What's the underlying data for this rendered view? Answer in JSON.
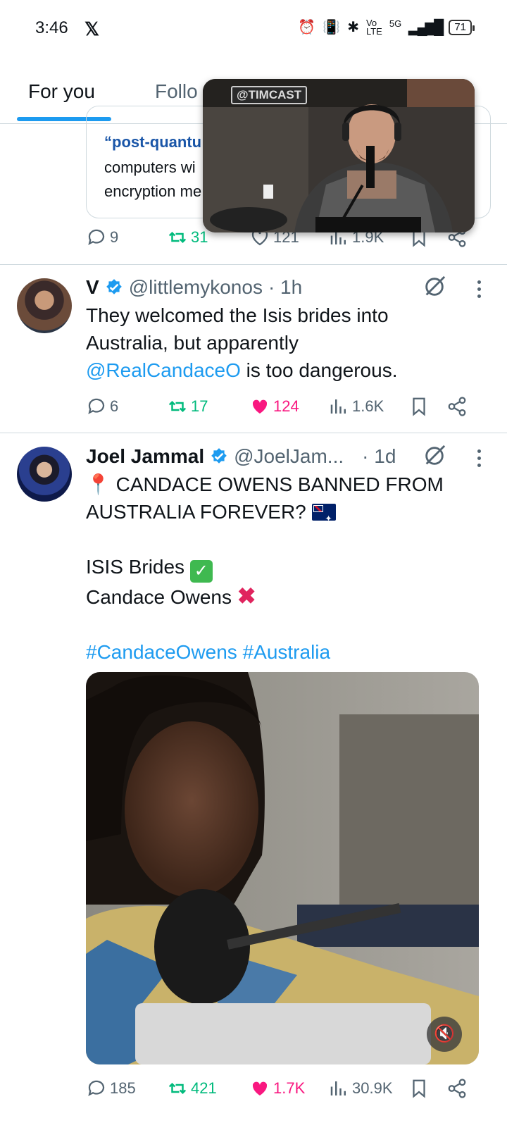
{
  "status_bar": {
    "time": "3:46",
    "x_logo": "𝕏",
    "network": "5G",
    "battery": "71"
  },
  "tabs": [
    {
      "label": "For you",
      "active": true
    },
    {
      "label": "Follo",
      "active": false
    }
  ],
  "quote_card": {
    "line1": "“post-quantu",
    "line2": "computers wi",
    "line3": "encryption me"
  },
  "pip": {
    "sign_text": "@TIMCAST"
  },
  "tweet0_actions": {
    "replies": "9",
    "reposts": "31",
    "likes": "121",
    "views": "1.9K"
  },
  "tweet1": {
    "name": "V",
    "handle": "@littlemykonos",
    "time": "· 1h",
    "text_line1": "They welcomed the Isis brides into",
    "text_line2": "Australia, but apparently",
    "mention": "@RealCandaceO",
    "text_line3_rest": " is too dangerous.",
    "actions": {
      "replies": "6",
      "reposts": "17",
      "likes": "124",
      "views": "1.6K"
    }
  },
  "tweet2": {
    "name": "Joel Jammal",
    "handle": "@JoelJam...",
    "time": "· 1d",
    "pin": "📍",
    "line1": " CANDACE OWENS BANNED FROM",
    "line2": "AUSTRALIA FOREVER? ",
    "line3": "ISIS Brides ",
    "check": "✓",
    "line4": "Candace Owens ",
    "cross": "✖",
    "hashtags": "#CandaceOwens #Australia",
    "actions": {
      "replies": "185",
      "reposts": "421",
      "likes": "1.7K",
      "views": "30.9K"
    }
  },
  "colors": {
    "accent": "#1d9bf0",
    "repost": "#00ba7c",
    "like": "#f91880",
    "muted": "#536471"
  }
}
